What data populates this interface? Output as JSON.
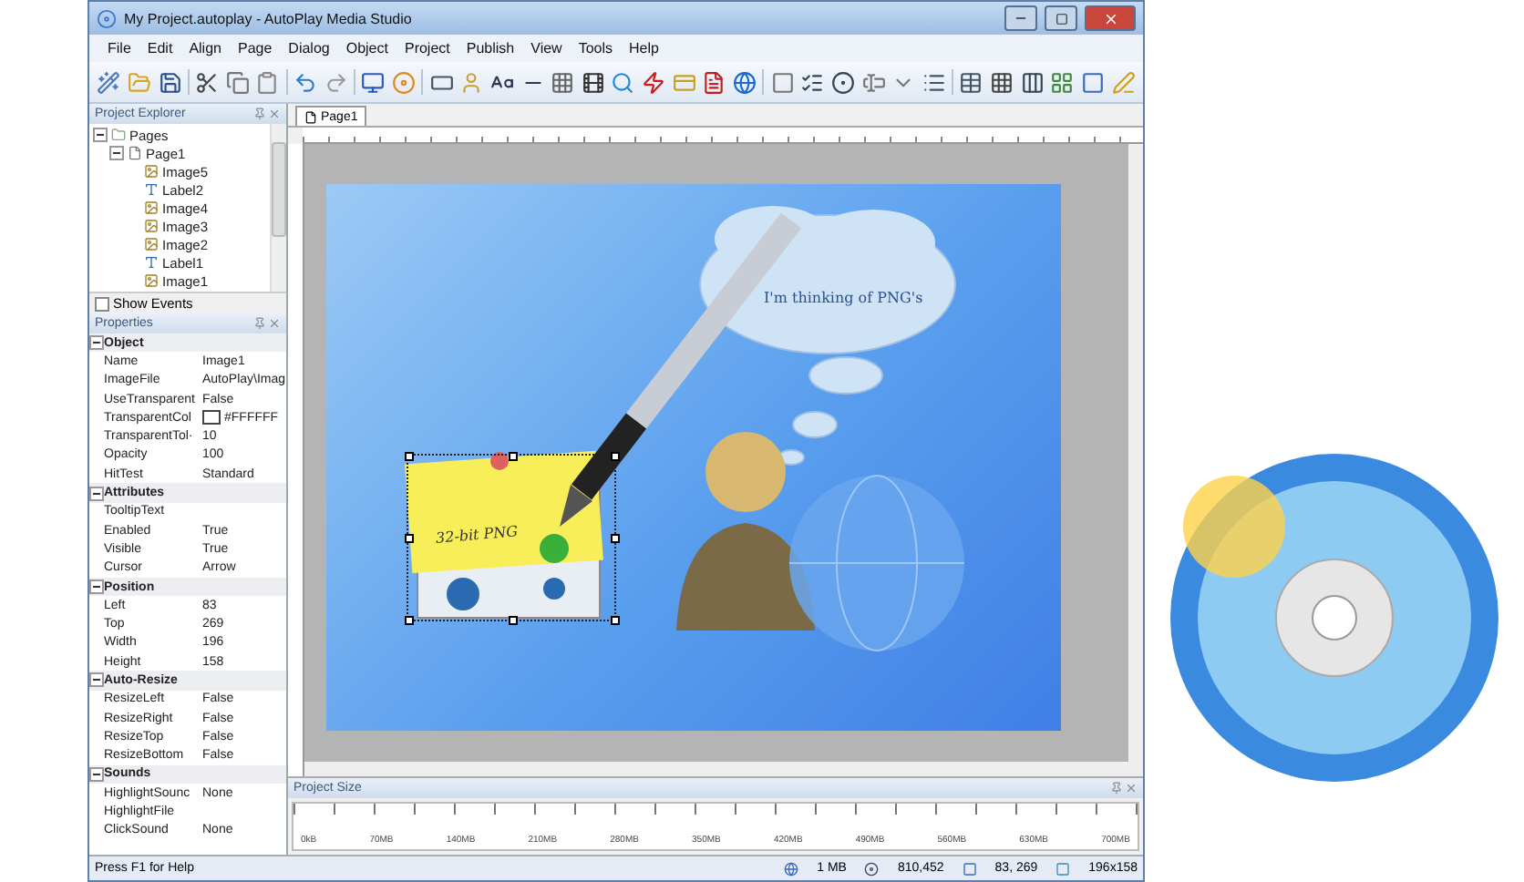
{
  "window": {
    "title": "My Project.autoplay - AutoPlay Media Studio"
  },
  "menu": [
    "File",
    "Edit",
    "Align",
    "Page",
    "Dialog",
    "Object",
    "Project",
    "Publish",
    "View",
    "Tools",
    "Help"
  ],
  "project_explorer": {
    "title": "Project Explorer",
    "tree": [
      {
        "label": "Pages",
        "kind": "folder",
        "expanded": true,
        "children": [
          {
            "label": "Page1",
            "kind": "page",
            "expanded": true,
            "children": [
              {
                "label": "Image5",
                "kind": "image"
              },
              {
                "label": "Label2",
                "kind": "label"
              },
              {
                "label": "Image4",
                "kind": "image"
              },
              {
                "label": "Image3",
                "kind": "image"
              },
              {
                "label": "Image2",
                "kind": "image"
              },
              {
                "label": "Label1",
                "kind": "label"
              },
              {
                "label": "Image1",
                "kind": "image"
              }
            ]
          }
        ]
      }
    ],
    "show_events": {
      "label": "Show Events",
      "checked": false
    }
  },
  "properties": {
    "title": "Properties",
    "rows": [
      {
        "kind": "group",
        "label": "Object",
        "expanded": true
      },
      {
        "kind": "prop",
        "label": "Name",
        "value": "Image1"
      },
      {
        "kind": "prop",
        "label": "ImageFile",
        "value": "AutoPlay\\Imag"
      },
      {
        "kind": "prop",
        "label": "UseTransparent",
        "value": "False"
      },
      {
        "kind": "color",
        "label": "TransparentCol",
        "value": "#FFFFFF",
        "color": "#ffffff"
      },
      {
        "kind": "prop",
        "label": "TransparentTol·",
        "value": "10"
      },
      {
        "kind": "prop",
        "label": "Opacity",
        "value": "100"
      },
      {
        "kind": "prop",
        "label": "HitTest",
        "value": "Standard"
      },
      {
        "kind": "group",
        "label": "Attributes",
        "expanded": true
      },
      {
        "kind": "prop",
        "label": "TooltipText",
        "value": ""
      },
      {
        "kind": "prop",
        "label": "Enabled",
        "value": "True"
      },
      {
        "kind": "prop",
        "label": "Visible",
        "value": "True"
      },
      {
        "kind": "prop",
        "label": "Cursor",
        "value": "Arrow"
      },
      {
        "kind": "group",
        "label": "Position",
        "expanded": true
      },
      {
        "kind": "prop",
        "label": "Left",
        "value": "83"
      },
      {
        "kind": "prop",
        "label": "Top",
        "value": "269"
      },
      {
        "kind": "prop",
        "label": "Width",
        "value": "196"
      },
      {
        "kind": "prop",
        "label": "Height",
        "value": "158"
      },
      {
        "kind": "group",
        "label": "Auto-Resize",
        "expanded": true
      },
      {
        "kind": "prop",
        "label": "ResizeLeft",
        "value": "False"
      },
      {
        "kind": "prop",
        "label": "ResizeRight",
        "value": "False"
      },
      {
        "kind": "prop",
        "label": "ResizeTop",
        "value": "False"
      },
      {
        "kind": "prop",
        "label": "ResizeBottom",
        "value": "False"
      },
      {
        "kind": "group",
        "label": "Sounds",
        "expanded": true
      },
      {
        "kind": "prop",
        "label": "HighlightSounc",
        "value": "None"
      },
      {
        "kind": "prop",
        "label": "HighlightFile",
        "value": ""
      },
      {
        "kind": "prop",
        "label": "ClickSound",
        "value": "None"
      }
    ]
  },
  "tabs": [
    {
      "label": "Page1",
      "selected": true
    }
  ],
  "slide": {
    "thought_text": "I'm thinking of PNG's",
    "note_text": "32-bit PNG"
  },
  "project_size": {
    "title": "Project Size",
    "marks": [
      "0kB",
      "70MB",
      "140MB",
      "210MB",
      "280MB",
      "350MB",
      "420MB",
      "490MB",
      "560MB",
      "630MB",
      "700MB"
    ]
  },
  "status_bar": {
    "help": "Press F1 for Help",
    "size": "1 MB",
    "bytes": "810,452",
    "position": "83, 269",
    "dimensions": "196x158"
  }
}
